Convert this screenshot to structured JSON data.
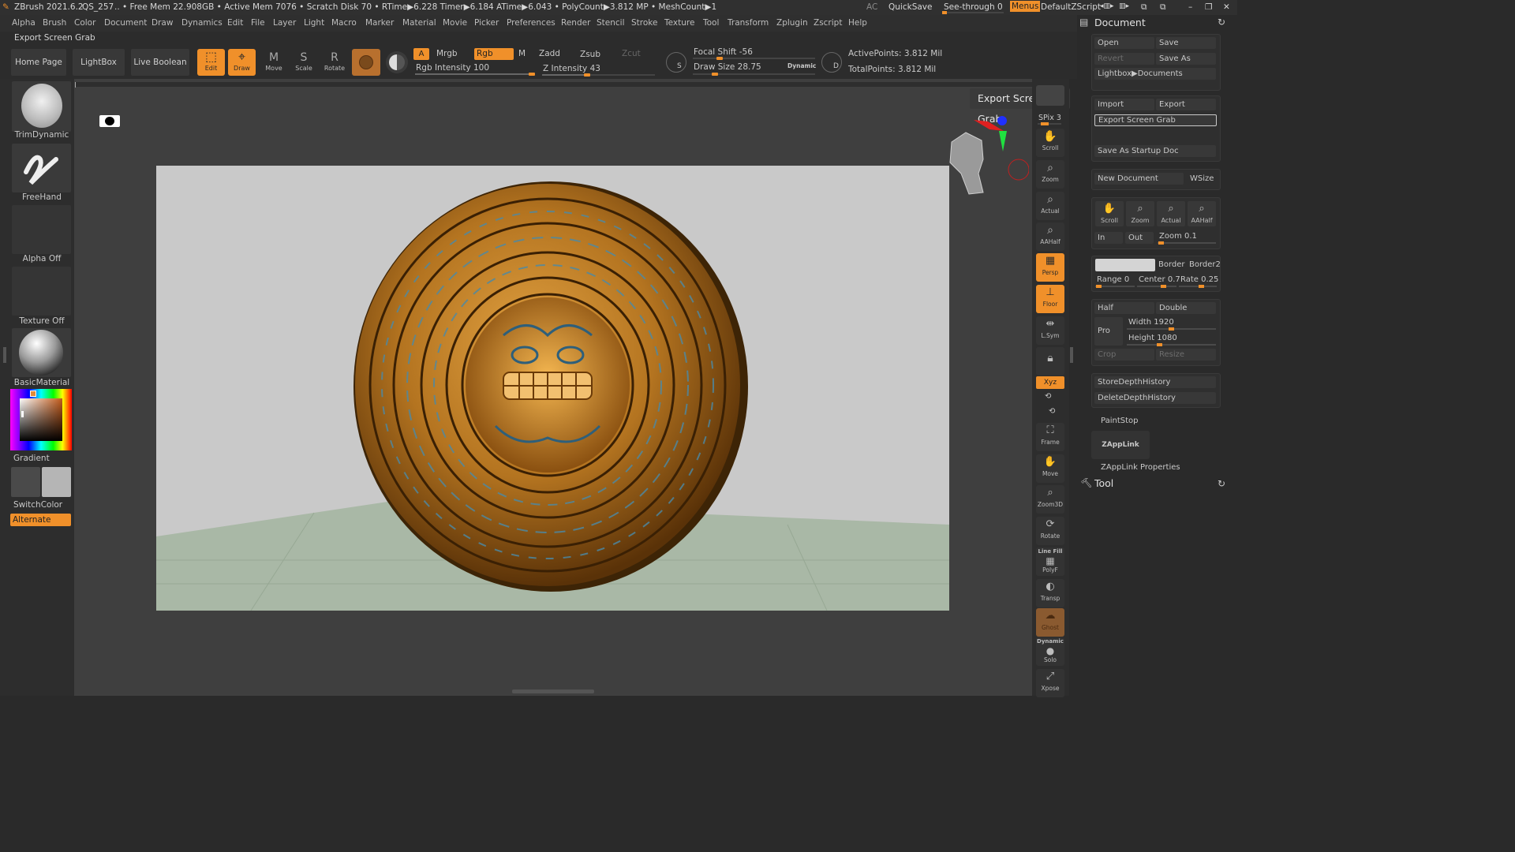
{
  "titlebar": {
    "app": "ZBrush 2021.6.2",
    "project": "QS_257",
    "stats": ".. • Free Mem 22.908GB • Active Mem 7076 • Scratch Disk 70 •  RTime▶6.228 Timer▶6.184 ATime▶6.043 • PolyCount▶3.812 MP  • MeshCount▶1",
    "ac": "AC",
    "quicksave": "QuickSave",
    "seethrough": "See-through  0",
    "menus": "Menus",
    "script": "DefaultZScript"
  },
  "menu": [
    "Alpha",
    "Brush",
    "Color",
    "Document",
    "Draw",
    "Dynamics",
    "Edit",
    "File",
    "Layer",
    "Light",
    "Macro",
    "Marker",
    "Material",
    "Movie",
    "Picker",
    "Preferences",
    "Render",
    "Stencil",
    "Stroke",
    "Texture",
    "Tool",
    "Transform",
    "Zplugin",
    "Zscript",
    "Help"
  ],
  "subheader": "Export Screen Grab",
  "toolbar": {
    "home": "Home Page",
    "lightbox": "LightBox",
    "liveboolean": "Live Boolean",
    "edit": "Edit",
    "draw": "Draw",
    "move": "Move",
    "scale": "Scale",
    "rotate": "Rotate",
    "a": "A",
    "mrgb": "Mrgb",
    "rgb": "Rgb",
    "m": "M",
    "zadd": "Zadd",
    "zsub": "Zsub",
    "zcut": "Zcut",
    "rgb_intensity": "Rgb Intensity 100",
    "z_intensity": "Z Intensity 43",
    "focal_shift": "Focal Shift -56",
    "draw_size": "Draw Size 28.75",
    "dynamic": "Dynamic",
    "active_points": "ActivePoints: 3.812 Mil",
    "total_points": "TotalPoints: 3.812 Mil",
    "s": "S",
    "d": "D",
    "rgb_intensity_level": 1.0,
    "z_intensity_level": 0.43
  },
  "leftshelf": {
    "brush1": "TrimDynamic",
    "brush2": "FreeHand",
    "alpha": "Alpha Off",
    "texture": "Texture Off",
    "material": "BasicMaterial",
    "gradient": "Gradient",
    "switchcolor": "SwitchColor",
    "alternate": "Alternate"
  },
  "viewport": {
    "tooltip": "Export Screen Grab"
  },
  "rightshelf": {
    "spix": "SPix 3",
    "buttons": [
      "Scroll",
      "Zoom",
      "Actual",
      "AAHalf",
      "Persp",
      "Floor",
      "L.Sym",
      "",
      "Xyz",
      "",
      "",
      "Frame",
      "Move",
      "Zoom3D",
      "Rotate",
      "PolyF",
      "Transp",
      "Ghost",
      "Solo",
      "Xpose"
    ],
    "dynamic": "Dynamic",
    "linefill": "Line Fill"
  },
  "document_panel": {
    "title": "Document",
    "open": "Open",
    "save": "Save",
    "revert": "Revert",
    "save_as": "Save As",
    "lightbox_documents": "Lightbox▶Documents",
    "import": "Import",
    "export": "Export",
    "export_screen_grab": "Export Screen Grab",
    "save_startup": "Save As Startup Doc",
    "new_document": "New Document",
    "wsize": "WSize",
    "nav": [
      "Scroll",
      "Zoom",
      "Actual",
      "AAHalf"
    ],
    "in": "In",
    "out": "Out",
    "zoom": "Zoom 0.1",
    "border": "Border",
    "border2": "Border2",
    "range": "Range 0",
    "center": "Center 0.7",
    "rate": "Rate 0.25",
    "half": "Half",
    "double": "Double",
    "pro": "Pro",
    "width": "Width 1920",
    "height": "Height 1080",
    "crop": "Crop",
    "resize": "Resize",
    "store_depth": "StoreDepthHistory",
    "delete_depth": "DeleteDepthHistory",
    "paintstop": "PaintStop",
    "zapplink": "ZAppLink",
    "zapplink_props": "ZAppLink Properties",
    "tool": "Tool"
  },
  "colors": {
    "accent": "#f0902a",
    "background": "#2a2a2a",
    "document_bg": "#c9c9c9",
    "floor": "#a9b8a6"
  }
}
